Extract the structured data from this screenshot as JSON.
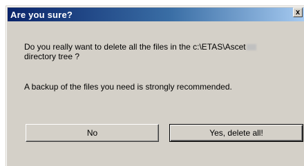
{
  "dialog": {
    "title": "Are you sure?",
    "close_glyph": "x",
    "message_line1": "Do you really want to delete all the files in the c:\\ETAS\\Ascet",
    "message_line2": "directory tree ?",
    "message_backup": "A backup of the files you need is strongly recommended.",
    "buttons": {
      "no_label": "No",
      "yes_label": "Yes, delete all!"
    }
  },
  "colors": {
    "title_gradient_start": "#0a246a",
    "title_gradient_end": "#a6caf0",
    "dialog_face": "#d4d0c8"
  }
}
